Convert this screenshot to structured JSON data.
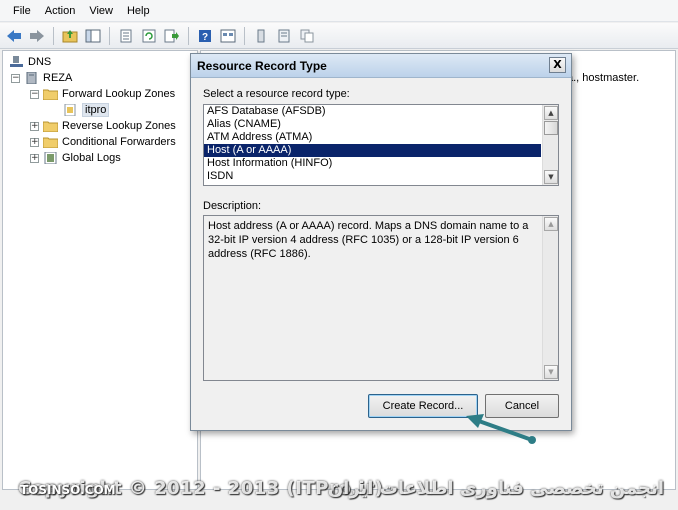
{
  "menu": [
    "File",
    "Action",
    "View",
    "Help"
  ],
  "toolbar": {
    "icons": [
      "back-arrow-icon",
      "forward-arrow-icon",
      "up-folder-icon",
      "show-hide-tree-icon",
      "properties-icon",
      "refresh-icon",
      "export-list-icon",
      "help-icon",
      "console-tree-icon",
      "zone-icon",
      "server-icon",
      "list-view-icon",
      "copy-icon"
    ]
  },
  "tree": {
    "root": "DNS",
    "server": "REZA",
    "forward": "Forward Lookup Zones",
    "zone": "itpro",
    "reverse": "Reverse Lookup Zones",
    "conditional": "Conditional Forwarders",
    "logs": "Global Logs"
  },
  "right_pane": {
    "fragment": "a., hostmaster."
  },
  "dialog": {
    "title": "Resource Record Type",
    "select_label": "Select a resource record type:",
    "records": [
      "AFS Database (AFSDB)",
      "Alias (CNAME)",
      "ATM Address (ATMA)",
      "Host (A or AAAA)",
      "Host Information (HINFO)",
      "ISDN"
    ],
    "selected_index": 3,
    "description_label": "Description:",
    "description": "Host address (A or AAAA) record. Maps a DNS domain name to a 32-bit IP version 4 address (RFC 1035) or a 128-bit IP version 6 address (RFC 1886).",
    "create_button": "Create Record...",
    "cancel_button": "Cancel",
    "close_glyph": "X"
  },
  "watermark": {
    "left": "Copyright © 2012 - 2013 (ITPro.ir) -",
    "overlay": "TOSINSO.COM",
    "right": "انجمن تخصصی فناوری اطلاعات ایران"
  },
  "colors": {
    "selection": "#0a246a",
    "arrow": "#2e7d86"
  }
}
